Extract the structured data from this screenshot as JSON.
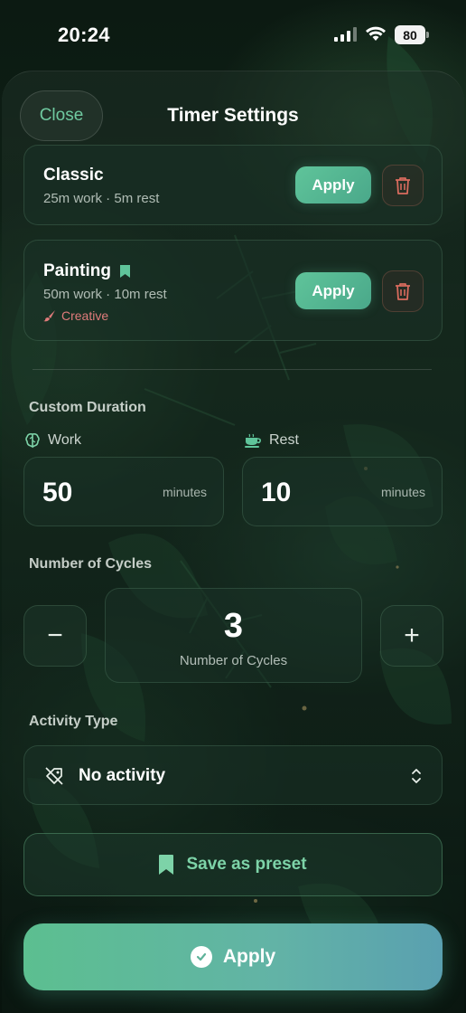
{
  "status_bar": {
    "time": "20:24",
    "battery": "80"
  },
  "header": {
    "close_label": "Close",
    "title": "Timer Settings"
  },
  "presets": [
    {
      "name": "Classic",
      "detail": "25m work · 5m rest",
      "apply_label": "Apply",
      "tag": ""
    },
    {
      "name": "Painting",
      "detail": "50m work · 10m rest",
      "apply_label": "Apply",
      "tag": "Creative"
    }
  ],
  "custom_duration": {
    "section_label": "Custom Duration",
    "work": {
      "label": "Work",
      "value": "50",
      "unit": "minutes"
    },
    "rest": {
      "label": "Rest",
      "value": "10",
      "unit": "minutes"
    }
  },
  "cycles": {
    "section_label": "Number of Cycles",
    "value": "3",
    "caption": "Number of Cycles",
    "minus": "−",
    "plus": "+"
  },
  "activity": {
    "section_label": "Activity Type",
    "selected": "No activity"
  },
  "save_preset_label": "Save as preset",
  "apply_label": "Apply",
  "colors": {
    "accent": "#5fc49a",
    "danger": "#d96b5e",
    "tag": "#e07b7b"
  }
}
